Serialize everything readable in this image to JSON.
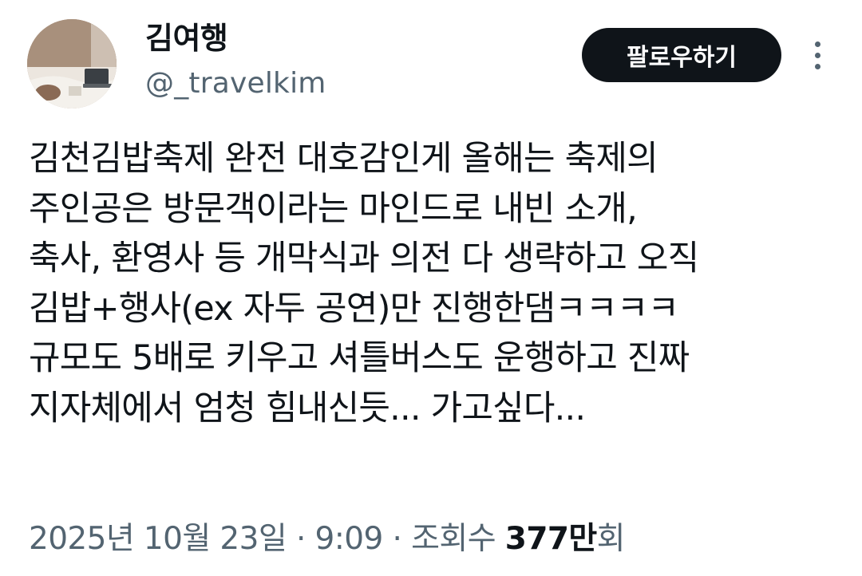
{
  "author": {
    "display_name": "김여행",
    "handle": "@_travelkim"
  },
  "actions": {
    "follow_label": "팔로우하기",
    "more_icon": "more-vertical-icon"
  },
  "tweet": {
    "lines": [
      "김천김밥축제 완전 대호감인게 올해는 축제의",
      "주인공은 방문객이라는 마인드로 내빈 소개,",
      "축사, 환영사 등 개막식과 의전 다 생략하고 오직",
      "김밥+행사(ex 자두 공연)만 진행한댐ㅋㅋㅋㅋ",
      "규모도 5배로 키우고 셔틀버스도 운행하고 진짜",
      "지자체에서 엄청 힘내신듯... 가고싶다..."
    ]
  },
  "meta": {
    "date": "2025년 10월 23일",
    "separator": " · ",
    "time": "9:09",
    "views_label": "조회수 ",
    "views_count": "377만",
    "views_suffix": "회"
  },
  "colors": {
    "text_primary": "#0f1419",
    "text_secondary": "#536471",
    "button_bg": "#0f1419",
    "button_text": "#ffffff",
    "background": "#ffffff"
  }
}
